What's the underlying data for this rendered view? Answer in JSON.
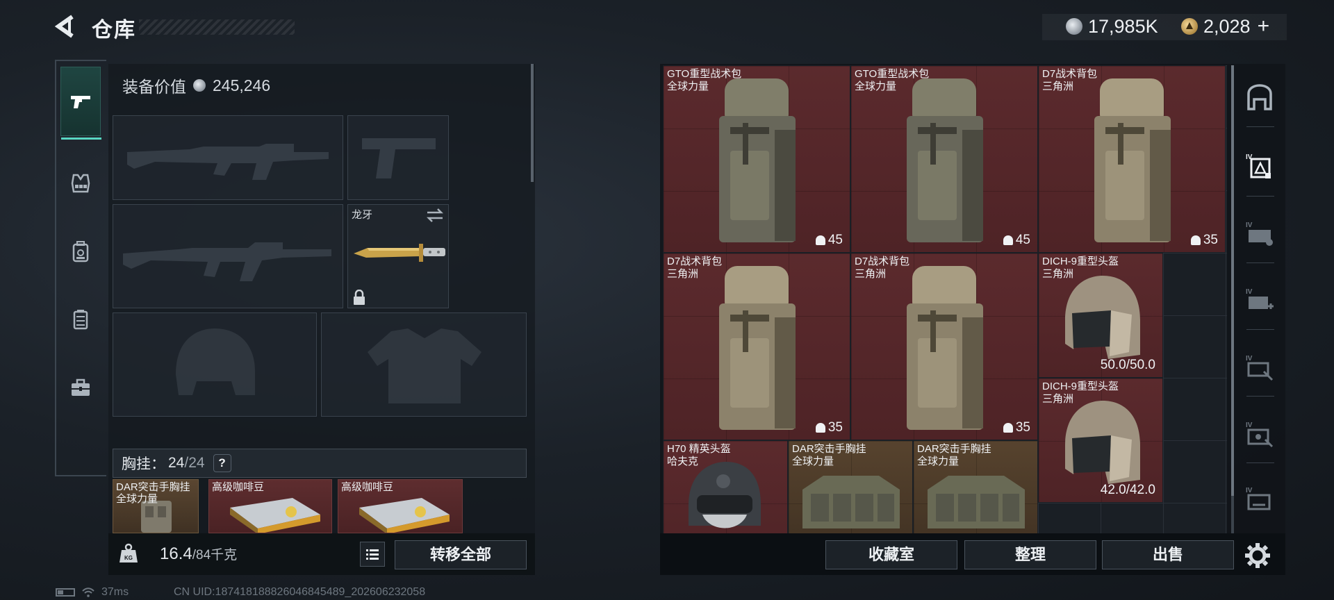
{
  "header": {
    "title": "仓库",
    "currency_silver": "17,985K",
    "currency_gold": "2,028",
    "gold_plus": "+"
  },
  "left_nav": {
    "items": [
      "pistol-icon",
      "vest-icon",
      "backpack-icon",
      "chest-rig-icon",
      "toolbox-icon"
    ],
    "active": "pistol-icon"
  },
  "equipment": {
    "value_label": "装备价值",
    "value": "245,246",
    "melee_label": "龙牙",
    "chest_rig_label": "胸挂：",
    "chest_rig_used": "24",
    "chest_rig_cap": "/24",
    "help": "?",
    "mini_items": [
      {
        "name": "DAR突击手胸挂",
        "sub": "全球力量"
      },
      {
        "name": "高级咖啡豆",
        "sub": ""
      },
      {
        "name": "高级咖啡豆",
        "sub": ""
      }
    ],
    "weight": "16.4",
    "weight_cap": "/84千克",
    "transfer_all": "转移全部"
  },
  "stash": {
    "items": [
      {
        "name": "GTO重型战术包",
        "sub": "全球力量",
        "stat": "45"
      },
      {
        "name": "GTO重型战术包",
        "sub": "全球力量",
        "stat": "45"
      },
      {
        "name": "D7战术背包",
        "sub": "三角洲",
        "stat": "35"
      },
      {
        "name": "D7战术背包",
        "sub": "三角洲",
        "stat": "35"
      },
      {
        "name": "D7战术背包",
        "sub": "三角洲",
        "stat": "35"
      },
      {
        "name": "DICH-9重型头盔",
        "sub": "三角洲",
        "stat": "50.0/50.0"
      },
      {
        "name": "DICH-9重型头盔",
        "sub": "三角洲",
        "stat": "42.0/42.0"
      },
      {
        "name": "H70 精英头盔",
        "sub": "哈夫克",
        "stat": ""
      },
      {
        "name": "DAR突击手胸挂",
        "sub": "全球力量",
        "stat": ""
      },
      {
        "name": "DAR突击手胸挂",
        "sub": "全球力量",
        "stat": ""
      }
    ],
    "buttons": {
      "collection": "收藏室",
      "organize": "整理",
      "sell": "出售"
    },
    "right_nav": [
      "stash-home-icon",
      "tier4-backpack-icon",
      "tier4-case-icon",
      "tier4-medical-icon",
      "tier4-tools-icon",
      "tier4-parts-icon",
      "tier4-misc-icon"
    ]
  },
  "status_bar": {
    "ping": "37ms",
    "uid": "CN UID:187418188826046845489_202606232058"
  },
  "colors": {
    "accent": "#58d8c2",
    "item_red": "#5b2a2d",
    "item_brown": "#57432e"
  }
}
